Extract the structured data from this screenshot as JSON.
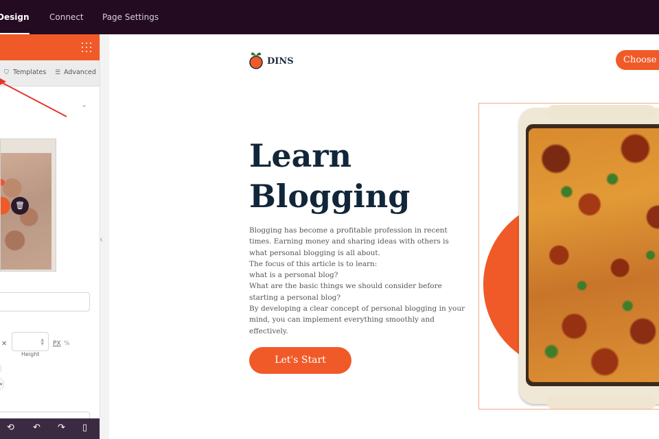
{
  "topbar": {
    "tabs": [
      {
        "label": "Design",
        "active": true
      },
      {
        "label": "Connect",
        "active": false
      },
      {
        "label": "Page Settings",
        "active": false
      }
    ]
  },
  "panel": {
    "subtabs": [
      {
        "label": "Templates",
        "icon": "paint-roller-icon"
      },
      {
        "label": "Advanced",
        "icon": "sliders-icon"
      }
    ],
    "size": {
      "height_label": "Height",
      "unit_px": "PX",
      "unit_pct": "%",
      "separator": "✕"
    },
    "colors": {
      "accent": "#f05a28",
      "topbar": "#230b22",
      "footer": "#3a2b43"
    }
  },
  "page": {
    "logo_text": "DINS",
    "choose_button": "Choose N",
    "hero_title": [
      "Learn",
      "Blogging"
    ],
    "hero_body": [
      "Blogging has become a profitable profession in recent",
      "times. Earning money and sharing ideas with others is",
      "what personal blogging is all about.",
      "The focus of this article is to learn:",
      "what is a personal blog?",
      "What are the basic things we should consider before",
      "starting a personal blog?",
      "By developing a clear concept of personal blogging in your",
      "mind, you can implement everything smoothly and",
      "effectively."
    ],
    "start_button": "Let's Start",
    "colors": {
      "heading": "#12263a",
      "accent": "#f05a28",
      "frame": "#f3a98b"
    }
  }
}
